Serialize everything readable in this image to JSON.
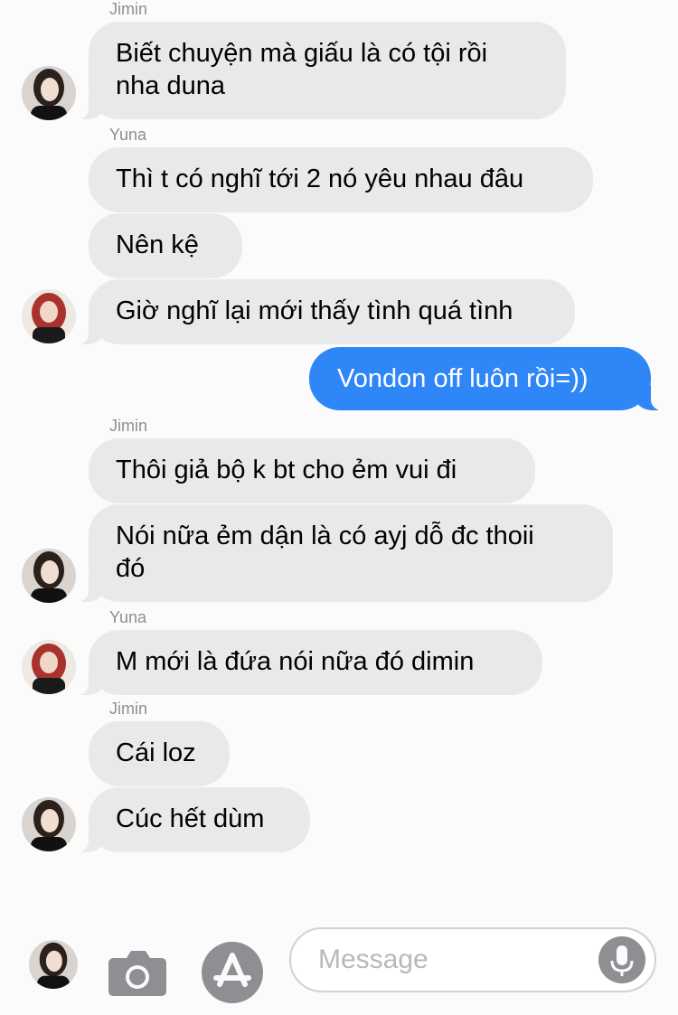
{
  "messages": [
    {
      "sender": "Jimin",
      "text1": "Biết chuyện mà giấu là có tội rồi",
      "text2": "nha duna"
    },
    {
      "sender": "Yuna",
      "text": "Thì t có nghĩ tới 2 nó yêu nhau đâu"
    },
    {
      "text": "Nên kệ"
    },
    {
      "text": "Giờ nghĩ lại mới thấy tình quá tình"
    },
    {
      "text": "Vondon off luôn rồi=))"
    },
    {
      "sender": "Jimin",
      "text": "Thôi giả bộ k bt cho ẻm vui đi"
    },
    {
      "text1": "Nói nữa ẻm dận là có ayj dỗ đc thoii",
      "text2": "đó"
    },
    {
      "sender": "Yuna",
      "text": "M mới là đứa nói nữa đó dimin"
    },
    {
      "sender": "Jimin",
      "text": "Cái loz"
    },
    {
      "text": "Cúc hết dùm"
    }
  ],
  "composer": {
    "placeholder": "Message"
  },
  "colors": {
    "incoming_bubble": "#e9e9eb",
    "outgoing_bubble": "#2f86f6",
    "background": "#fbfbfb"
  },
  "icons": [
    "camera-icon",
    "app-store-icon",
    "microphone-icon"
  ]
}
